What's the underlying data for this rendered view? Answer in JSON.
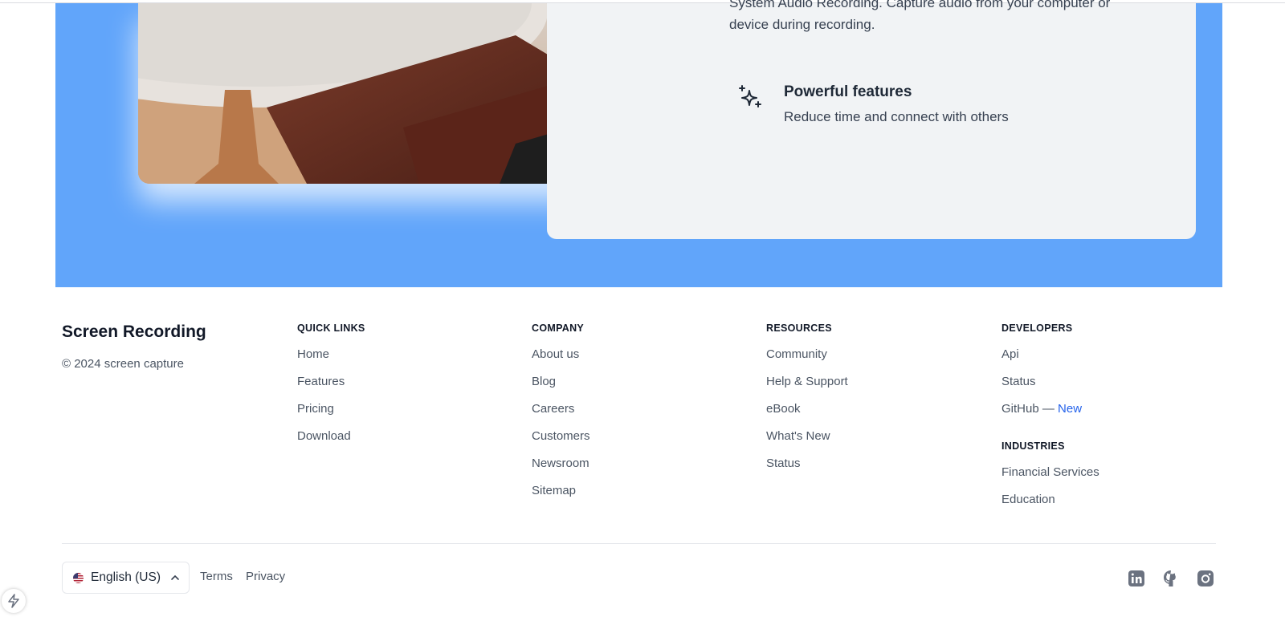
{
  "features": {
    "top_text": "System Audio Recording. Capture audio from your computer or device during recording.",
    "powerful_title": "Powerful features",
    "powerful_desc": "Reduce time and connect with others"
  },
  "footer": {
    "brand": "Screen Recording",
    "copyright": "© 2024 screen capture",
    "columns": {
      "quick_links": {
        "heading": "QUICK LINKS",
        "links": [
          "Home",
          "Features",
          "Pricing",
          "Download"
        ]
      },
      "company": {
        "heading": "COMPANY",
        "links": [
          "About us",
          "Blog",
          "Careers",
          "Customers",
          "Newsroom",
          "Sitemap"
        ]
      },
      "resources": {
        "heading": "RESOURCES",
        "links": [
          "Community",
          "Help & Support",
          "eBook",
          "What's New",
          "Status"
        ]
      },
      "developers": {
        "heading": "DEVELOPERS",
        "links": [
          "Api",
          "Status",
          "GitHub — "
        ],
        "new_badge": "New"
      },
      "industries": {
        "heading": "INDUSTRIES",
        "links": [
          "Financial Services",
          "Education"
        ]
      }
    },
    "language": "English (US)",
    "terms": "Terms",
    "privacy": "Privacy",
    "social_icons": [
      "linkedin-icon",
      "github-icon",
      "instagram-icon"
    ]
  },
  "colors": {
    "band": "#61a5fa",
    "panel": "#f1f3f5",
    "accent": "#2563eb"
  }
}
